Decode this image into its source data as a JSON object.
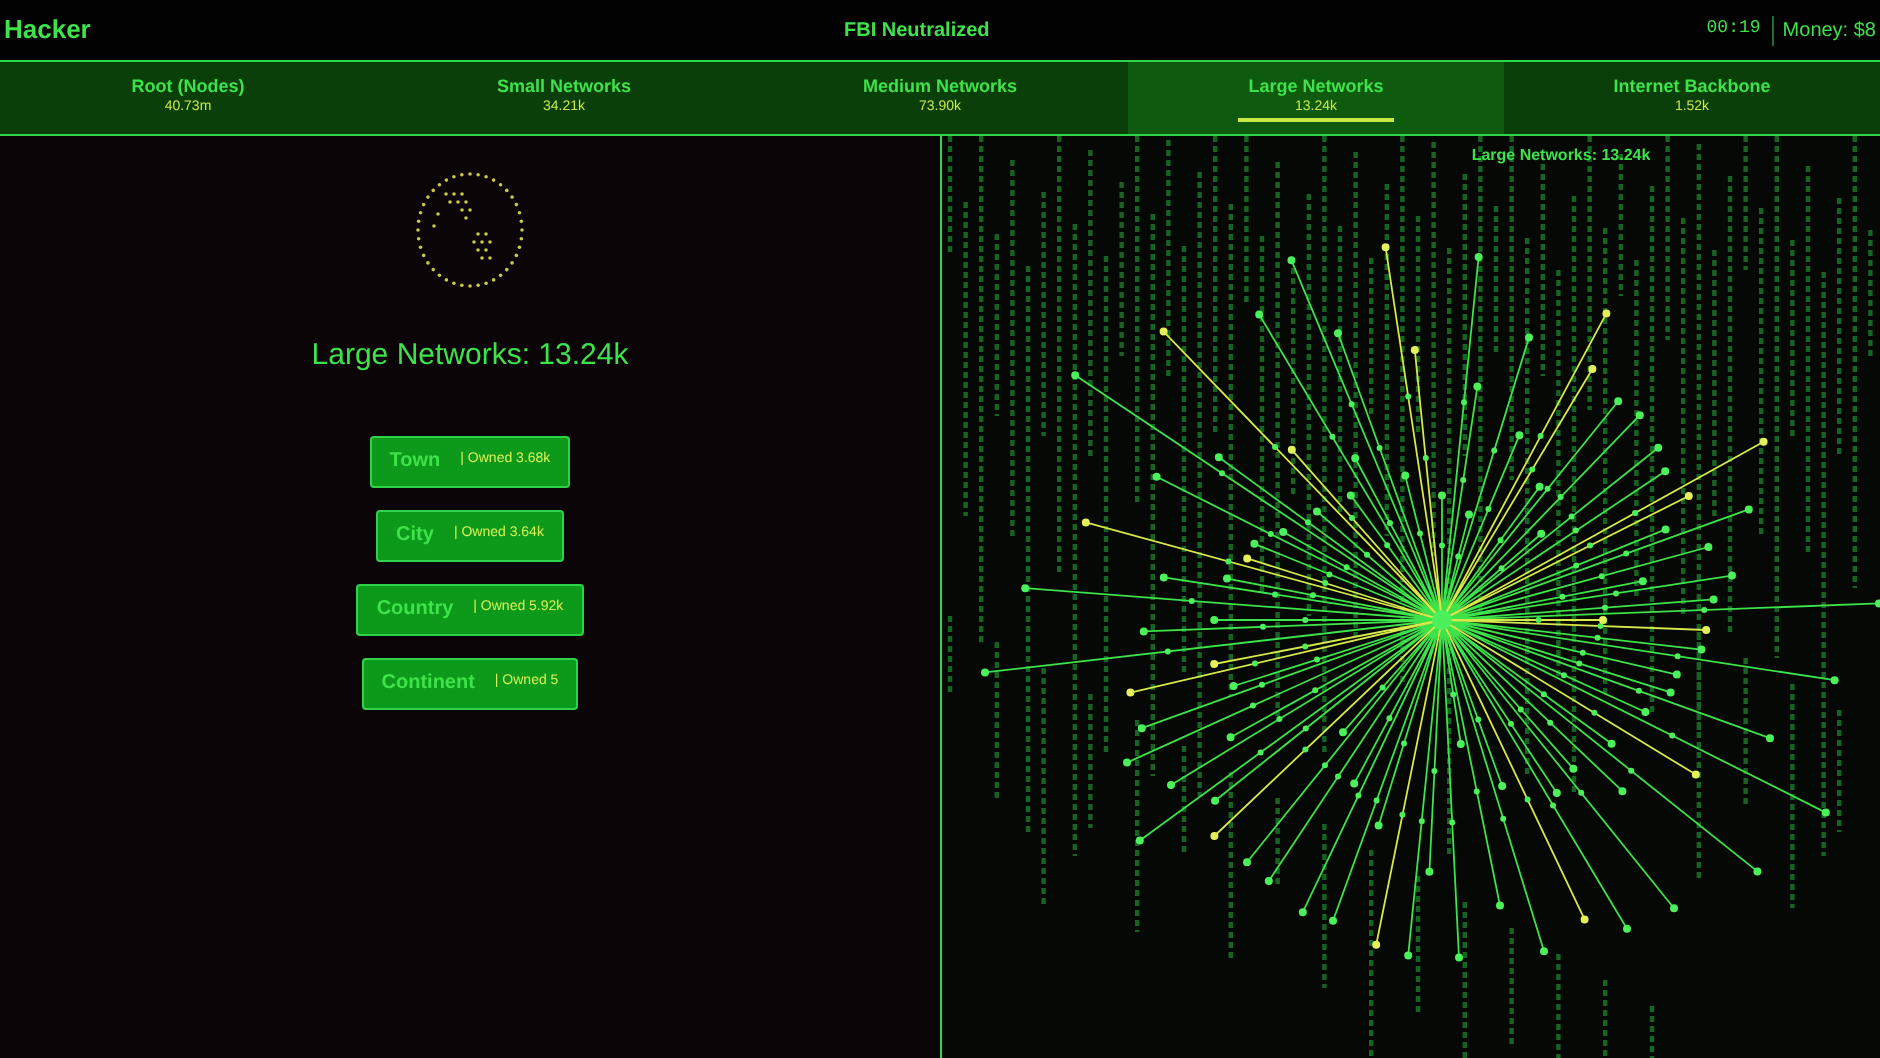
{
  "header": {
    "title": "Hacker",
    "status": "FBI Neutralized",
    "timer": "00:19",
    "money": "Money: $8"
  },
  "tabs": [
    {
      "label": "Root (Nodes)",
      "count": "40.73m",
      "selected": false
    },
    {
      "label": "Small Networks",
      "count": "34.21k",
      "selected": false
    },
    {
      "label": "Medium Networks",
      "count": "73.90k",
      "selected": false
    },
    {
      "label": "Large Networks",
      "count": "13.24k",
      "selected": true
    },
    {
      "label": "Internet Backbone",
      "count": "1.52k",
      "selected": false
    }
  ],
  "left_panel": {
    "heading": "Large Networks: 13.24k",
    "buttons": [
      {
        "label": "Town",
        "owned": "| Owned 3.68k"
      },
      {
        "label": "City",
        "owned": "| Owned 3.64k"
      },
      {
        "label": "Country",
        "owned": "| Owned 5.92k"
      },
      {
        "label": "Continent",
        "owned": "| Owned 5"
      }
    ]
  },
  "graph_panel": {
    "title": "Large Networks: 13.24k"
  }
}
